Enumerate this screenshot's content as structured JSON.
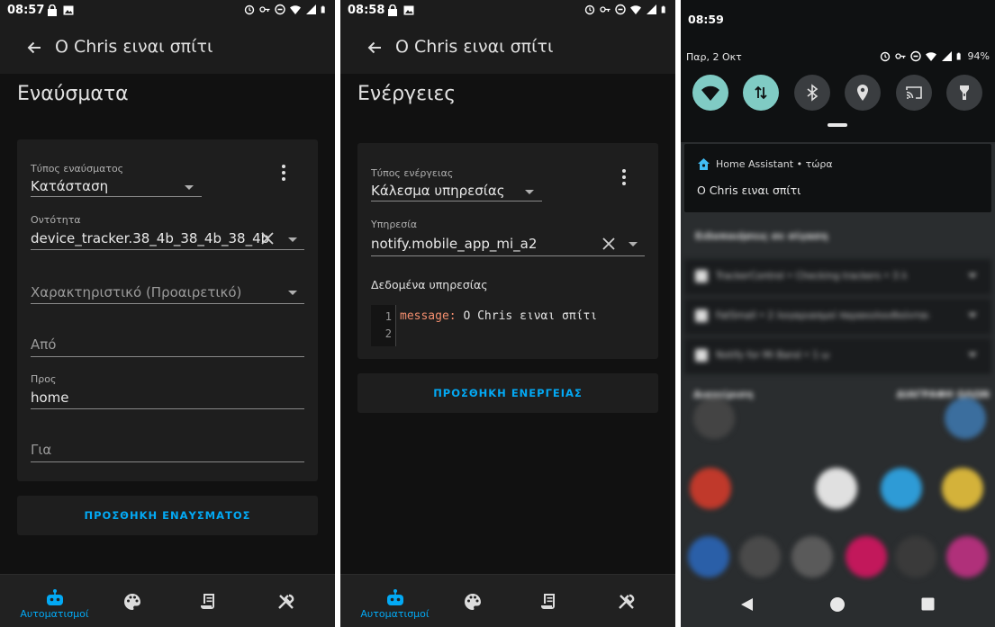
{
  "phone1": {
    "status_time": "08:57",
    "toolbar_title": "Ο Chris ειναι σπίτι",
    "section_title": "Εναύσματα",
    "trigger": {
      "type_label": "Τύπος εναύσματος",
      "type_value": "Κατάσταση",
      "entity_label": "Οντότητα",
      "entity_value": "device_tracker.38_4b_38_4b_38_4b",
      "attribute_placeholder": "Χαρακτηριστικό (Προαιρετικό)",
      "from_placeholder": "Από",
      "to_label": "Προς",
      "to_value": "home",
      "for_placeholder": "Για"
    },
    "add_button": "ΠΡΟΣΘΗΚΗ ΕΝΑΥΣΜΑΤΟΣ"
  },
  "phone2": {
    "status_time": "08:58",
    "toolbar_title": "Ο Chris ειναι σπίτι",
    "section_title": "Ενέργειες",
    "action": {
      "type_label": "Τύπος ενέργειας",
      "type_value": "Κάλεσμα υπηρεσίας",
      "service_label": "Υπηρεσία",
      "service_value": "notify.mobile_app_mi_a2",
      "data_label": "Δεδομένα υπηρεσίας",
      "code_lines": [
        "1",
        "2"
      ],
      "code_key": "message:",
      "code_value": " Ο Chris ειναι σπίτι"
    },
    "add_button": "ΠΡΟΣΘΗΚΗ ΕΝΕΡΓΕΙΑΣ"
  },
  "bottom_nav": {
    "automations_label": "Αυτοματισμοί",
    "accent_color": "#03a9f4"
  },
  "phone3": {
    "status_time": "08:59",
    "date": "Παρ, 2 Οκτ",
    "battery": "94%",
    "notification": {
      "app": "Home Assistant • τώρα",
      "body": "Ο Chris ειναι σπίτι"
    },
    "blurred": {
      "header": "Ειδοποιήσεις σε σίγαση",
      "rows": [
        "TrackerControl • Checking trackers • 3 λ",
        "FatSmall • 2 λογαριασμοί παρακολουθούνται",
        "Notify for Mi Band • 1 ω"
      ],
      "manage": "Διαχείριση",
      "clear": "ΔΙΑΓΡΑΦΗ ΟΛΩΝ"
    }
  }
}
